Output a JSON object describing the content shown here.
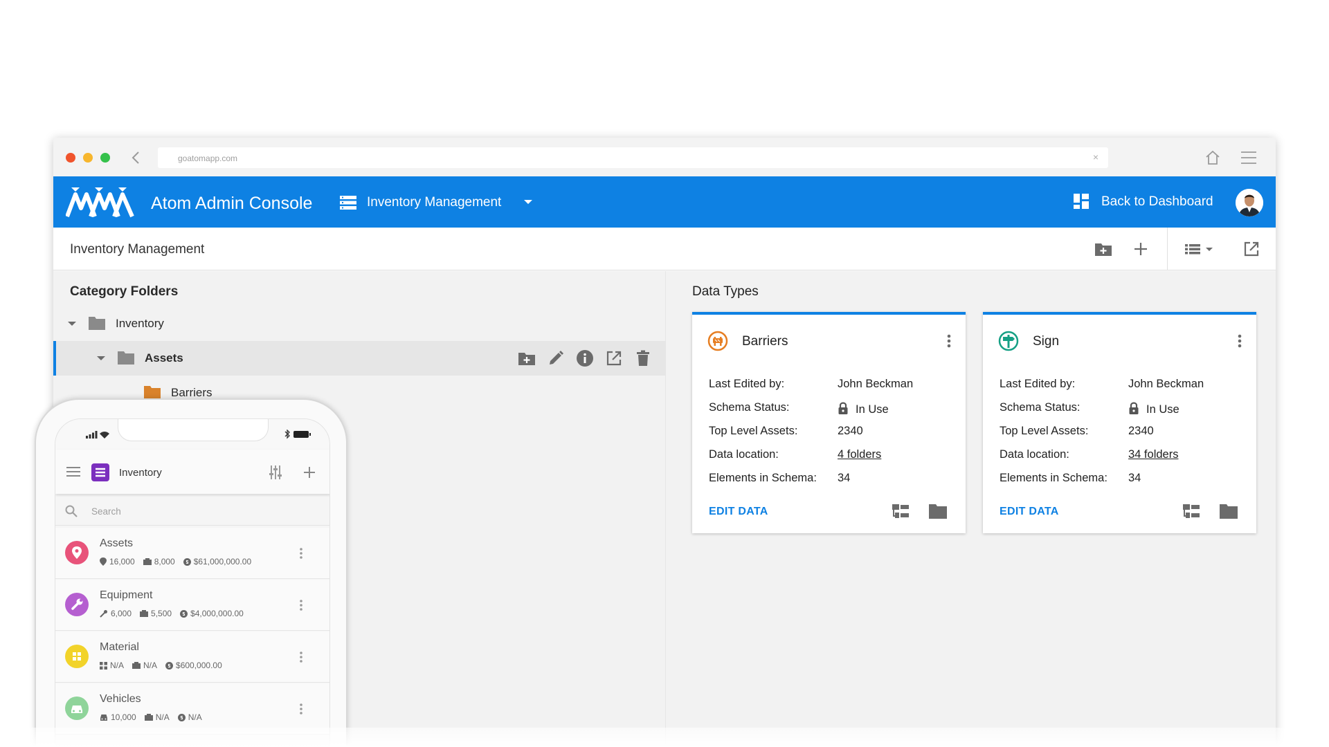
{
  "browser": {
    "url": "goatomapp.com",
    "url_clear": "×"
  },
  "appbar": {
    "title": "Atom Admin Console",
    "module": "Inventory Management",
    "dashboard_link": "Back to Dashboard"
  },
  "page": {
    "title": "Inventory Management"
  },
  "category_folders": {
    "title": "Category Folders",
    "tree": [
      {
        "label": "Inventory",
        "level": 0
      },
      {
        "label": "Assets",
        "level": 1,
        "selected": true
      },
      {
        "label": "Barriers",
        "level": 2
      }
    ]
  },
  "data_types": {
    "title": "Data Types",
    "field_labels": {
      "last_edited": "Last Edited by:",
      "schema_status": "Schema Status:",
      "top_level": "Top Level Assets:",
      "data_location": "Data location:",
      "elements": "Elements in Schema:"
    },
    "cards": [
      {
        "name": "Barriers",
        "icon": "barrier-icon",
        "icon_color": "#e67e22",
        "last_edited": "John Beckman",
        "schema_status": "In Use",
        "top_level": "2340",
        "data_location": "4 folders",
        "elements": "34",
        "action": "EDIT DATA"
      },
      {
        "name": "Sign",
        "icon": "sign-icon",
        "icon_color": "#16a085",
        "last_edited": "John Beckman",
        "schema_status": "In Use",
        "top_level": "2340",
        "data_location": "34 folders",
        "elements": "34",
        "action": "EDIT DATA"
      }
    ]
  },
  "phone": {
    "title": "Inventory",
    "search_placeholder": "Search",
    "items": [
      {
        "name": "Assets",
        "color": "#e8537a",
        "icon": "location-pin-icon",
        "stats": [
          "16,000",
          "8,000",
          "$61,000,000.00"
        ]
      },
      {
        "name": "Equipment",
        "color": "#b55fd0",
        "icon": "wrench-icon",
        "stats": [
          "6,000",
          "5,500",
          "$4,000,000.00"
        ]
      },
      {
        "name": "Material",
        "color": "#f2d32a",
        "icon": "grid-icon",
        "stats": [
          "N/A",
          "N/A",
          "$600,000.00"
        ]
      },
      {
        "name": "Vehicles",
        "color": "#8fd49a",
        "icon": "car-icon",
        "stats": [
          "10,000",
          "N/A",
          "N/A"
        ]
      }
    ]
  },
  "colors": {
    "primary": "#0e81e3",
    "close_dot": "#f0542c",
    "minimize_dot": "#f7b62d",
    "maximize_dot": "#35c14b"
  }
}
